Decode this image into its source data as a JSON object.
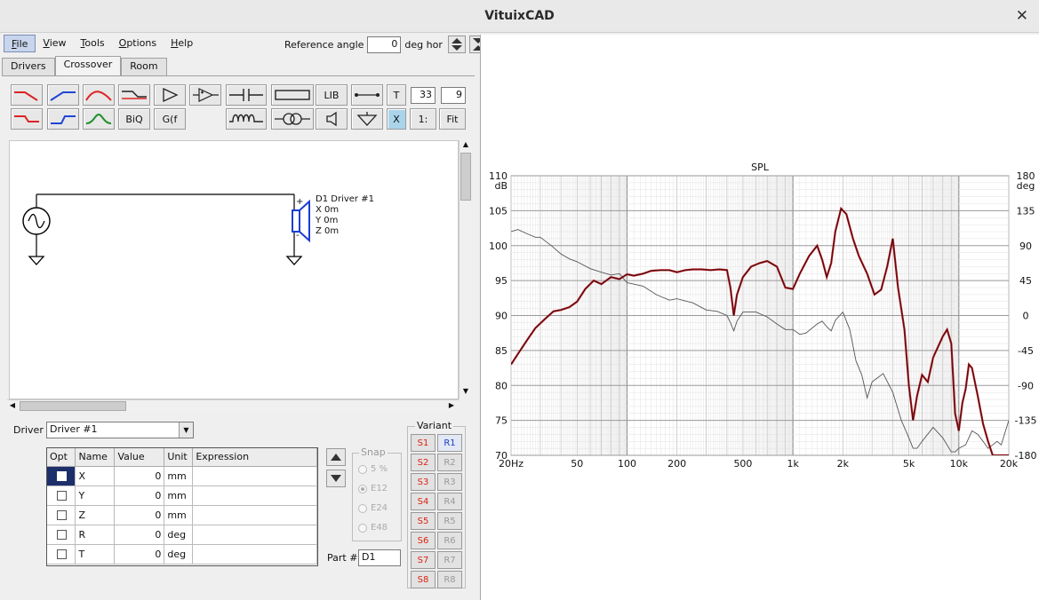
{
  "window": {
    "title": "VituixCAD",
    "close_glyph": "✕"
  },
  "menu": {
    "items": [
      {
        "label": "File",
        "hot": "F",
        "rest": "ile",
        "active": true
      },
      {
        "label": "View",
        "hot": "V",
        "rest": "iew",
        "active": false
      },
      {
        "label": "Tools",
        "hot": "T",
        "rest": "ools",
        "active": false
      },
      {
        "label": "Options",
        "hot": "O",
        "rest": "ptions",
        "active": false
      },
      {
        "label": "Help",
        "hot": "H",
        "rest": "elp",
        "active": false
      }
    ],
    "reference_angle_label": "Reference angle",
    "reference_angle_value": "0",
    "reference_angle_unit": "deg hor"
  },
  "tabs": [
    {
      "label": "Drivers",
      "active": false
    },
    {
      "label": "Crossover",
      "active": true
    },
    {
      "label": "Room",
      "active": false
    }
  ],
  "toolbar": {
    "row1": [
      "lowpass-red-icon",
      "highpass-blue-icon",
      "bandpass-red-icon",
      "shelf-icon",
      "amplifier-icon",
      "opamp-icon",
      "capacitor-icon",
      "resistor-icon"
    ],
    "lib_label": "LIB",
    "row2_text": {
      "biq": "BiQ",
      "gf": "G(f"
    },
    "t_label": "T",
    "t_value1": "33",
    "t_value2": "9",
    "x_label": "X",
    "ratio_label": "1:",
    "fit_label": "Fit"
  },
  "schematic": {
    "driver_name": "D1 Driver #1",
    "driver_x": "X 0m",
    "driver_y": "Y 0m",
    "driver_z": "Z 0m",
    "plus": "+",
    "minus": "-"
  },
  "driver": {
    "label": "Driver",
    "selected": "Driver #1"
  },
  "params": {
    "headers": [
      "Opt",
      "Name",
      "Value",
      "Unit",
      "Expression"
    ],
    "rows": [
      {
        "name": "X",
        "value": "0",
        "unit": "mm",
        "expr": "",
        "selected": true
      },
      {
        "name": "Y",
        "value": "0",
        "unit": "mm",
        "expr": "",
        "selected": false
      },
      {
        "name": "Z",
        "value": "0",
        "unit": "mm",
        "expr": "",
        "selected": false
      },
      {
        "name": "R",
        "value": "0",
        "unit": "deg",
        "expr": "",
        "selected": false
      },
      {
        "name": "T",
        "value": "0",
        "unit": "deg",
        "expr": "",
        "selected": false
      }
    ]
  },
  "snap": {
    "legend": "Snap",
    "options": [
      {
        "label": "5 %",
        "on": false
      },
      {
        "label": "E12",
        "on": true
      },
      {
        "label": "E24",
        "on": false
      },
      {
        "label": "E48",
        "on": false
      }
    ]
  },
  "part": {
    "label": "Part #",
    "value": "D1"
  },
  "variant": {
    "legend": "Variant",
    "s": [
      "S1",
      "S2",
      "S3",
      "S4",
      "S5",
      "S6",
      "S7",
      "S8"
    ],
    "r": [
      "R1",
      "R2",
      "R3",
      "R4",
      "R5",
      "R6",
      "R7",
      "R8"
    ],
    "active_r": 0
  },
  "chart_data": {
    "type": "line",
    "title": "SPL",
    "xlabel": "",
    "ylabel": "dB",
    "y2label": "deg",
    "x_scale": "log",
    "xlim": [
      20,
      20000
    ],
    "ylim": [
      70,
      110
    ],
    "y2lim": [
      -180,
      180
    ],
    "x_ticks": [
      {
        "v": 20,
        "label": "20Hz"
      },
      {
        "v": 50,
        "label": "50"
      },
      {
        "v": 100,
        "label": "100"
      },
      {
        "v": 200,
        "label": "200"
      },
      {
        "v": 500,
        "label": "500"
      },
      {
        "v": 1000,
        "label": "1k"
      },
      {
        "v": 2000,
        "label": "2k"
      },
      {
        "v": 5000,
        "label": "5k"
      },
      {
        "v": 10000,
        "label": "10k"
      },
      {
        "v": 20000,
        "label": "20k"
      }
    ],
    "y_ticks": [
      70,
      75,
      80,
      85,
      90,
      95,
      100,
      105,
      110
    ],
    "y2_ticks": [
      -180,
      -135,
      -90,
      -45,
      0,
      45,
      90,
      135,
      180
    ],
    "grid": true,
    "series": [
      {
        "axis": "left",
        "color": "#b3141b",
        "x": [
          20,
          22,
          25,
          28,
          32,
          36,
          40,
          45,
          50,
          56,
          63,
          70,
          80,
          90,
          100,
          110,
          125,
          140,
          160,
          180,
          200,
          225,
          250,
          280,
          320,
          360,
          400,
          420,
          440,
          460,
          500,
          560,
          630,
          700,
          800,
          900,
          1000,
          1100,
          1250,
          1400,
          1500,
          1600,
          1700,
          1800,
          1950,
          2100,
          2300,
          2500,
          2800,
          3100,
          3400,
          3700,
          4000,
          4300,
          4700,
          5000,
          5300,
          5600,
          6000,
          6500,
          7000,
          8000,
          8500,
          9000,
          9500,
          10000,
          10500,
          11000,
          11500,
          12000,
          13000,
          14000,
          15000,
          16000,
          18000,
          20000
        ],
        "y": [
          83,
          84.5,
          86.5,
          88.2,
          89.5,
          90.6,
          90.8,
          91.2,
          92.0,
          93.8,
          95.0,
          94.5,
          95.5,
          95.2,
          95.9,
          95.7,
          96.0,
          96.4,
          96.5,
          96.5,
          96.2,
          96.5,
          96.6,
          96.6,
          96.5,
          96.6,
          96.5,
          94.0,
          90.0,
          93.0,
          95.5,
          97.0,
          97.5,
          97.8,
          97.0,
          94.0,
          93.8,
          96.0,
          98.5,
          100.0,
          98.0,
          95.5,
          97.5,
          102.0,
          105.3,
          104.5,
          101.0,
          98.5,
          96.0,
          93.0,
          93.7,
          97.0,
          101.0,
          94.0,
          88.0,
          80.0,
          75.0,
          78.5,
          81.5,
          80.5,
          84.0,
          87.0,
          88.0,
          86.0,
          76.0,
          73.5,
          77.5,
          79.5,
          83.0,
          82.5,
          78.5,
          74.5,
          72.0,
          70.0,
          70.0,
          70.0
        ]
      },
      {
        "axis": "left",
        "color": "#555555",
        "x": [
          20,
          22,
          25,
          28,
          30,
          35,
          40,
          45,
          50,
          60,
          70,
          80,
          90,
          100,
          125,
          150,
          180,
          200,
          250,
          300,
          350,
          400,
          420,
          440,
          460,
          500,
          600,
          700,
          800,
          900,
          1000,
          1100,
          1200,
          1400,
          1500,
          1600,
          1700,
          1800,
          2000,
          2200,
          2400,
          2600,
          2800,
          3000,
          3200,
          3500,
          4000,
          4500,
          5000,
          5300,
          5600,
          6000,
          7000,
          8000,
          9000,
          9500,
          10000,
          11000,
          12000,
          13000,
          14000,
          15000,
          16000,
          17000,
          18000,
          20000
        ],
        "y": [
          102,
          102.3,
          101.7,
          101.2,
          101.2,
          100.0,
          98.8,
          98.1,
          97.7,
          96.7,
          96.2,
          95.8,
          96.0,
          94.7,
          94.2,
          93.0,
          92.2,
          92.4,
          91.8,
          90.8,
          90.6,
          90.0,
          89.0,
          87.8,
          89.2,
          90.5,
          90.5,
          89.8,
          88.8,
          88.0,
          88.0,
          87.3,
          87.5,
          88.8,
          89.2,
          88.4,
          87.8,
          89.3,
          90.5,
          88.0,
          83.5,
          81.5,
          78.2,
          80.5,
          81.0,
          81.7,
          79.0,
          75.0,
          72.5,
          71.0,
          71.0,
          72.0,
          74.0,
          72.5,
          70.5,
          70.5,
          71.0,
          71.5,
          73.5,
          73.0,
          72.0,
          71.0,
          71.5,
          72.0,
          71.5,
          75.0
        ]
      }
    ]
  }
}
